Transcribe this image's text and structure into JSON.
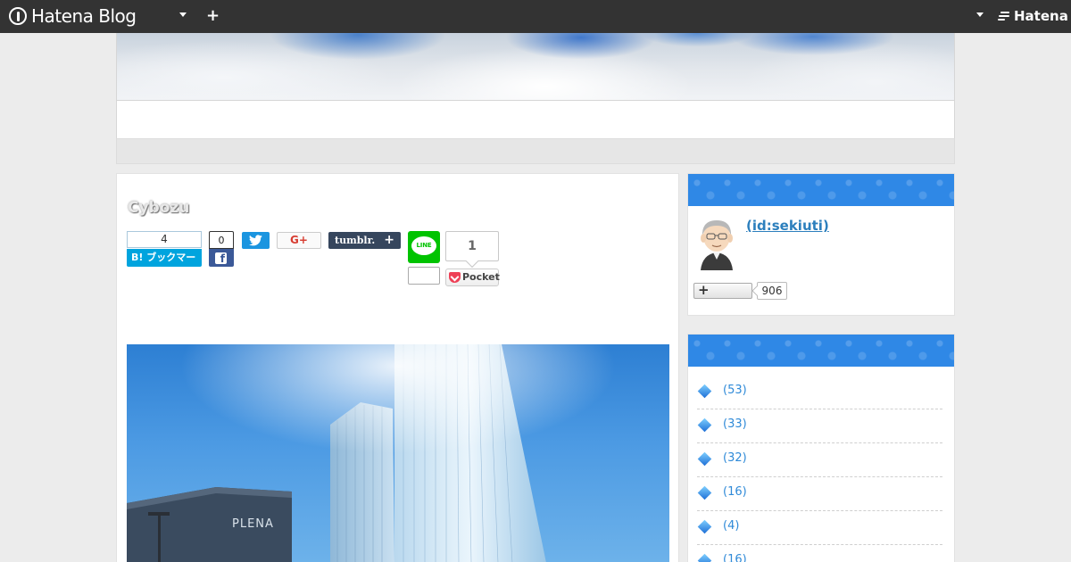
{
  "globalbar": {
    "brand": "Hatena Blog",
    "add_label": "+",
    "hatena_label": "Hatena"
  },
  "entry": {
    "title": "Cybozu",
    "share": {
      "hatena_bookmark_count": "4",
      "hatena_bookmark_label": "B! ブックマーク",
      "facebook_count": "0",
      "google_plus_label": "G+",
      "tumblr_label": "tumblr.",
      "tumblr_plus": "+",
      "line_label": "LINE",
      "pocket_count": "1",
      "pocket_label": "Pocket"
    },
    "photo_sign": "PLENA"
  },
  "sidebar": {
    "profile": {
      "id_label": " (id:sekiuti)",
      "subscribe_label": "+",
      "subscriber_count": "906"
    },
    "categories": [
      {
        "count": "(53)"
      },
      {
        "count": "(33)"
      },
      {
        "count": "(32)"
      },
      {
        "count": "(16)"
      },
      {
        "count": "(4)"
      },
      {
        "count": "(16)"
      }
    ]
  },
  "colors": {
    "globalbar": "#333333",
    "sidebar_header": "#2f88e6",
    "link": "#2c7fbd",
    "hatena_bookmark": "#00a4de",
    "facebook": "#3b5998",
    "twitter": "#1b95e0",
    "tumblr": "#36465d",
    "line": "#00c300",
    "pocket": "#ee4056"
  },
  "icons": [
    "hatena-blog-logo-icon",
    "chevron-down-icon",
    "plus-icon",
    "hatena-logo-icon",
    "twitter-bird-icon",
    "facebook-f-icon",
    "line-icon",
    "pocket-icon",
    "category-diamond-icon"
  ]
}
